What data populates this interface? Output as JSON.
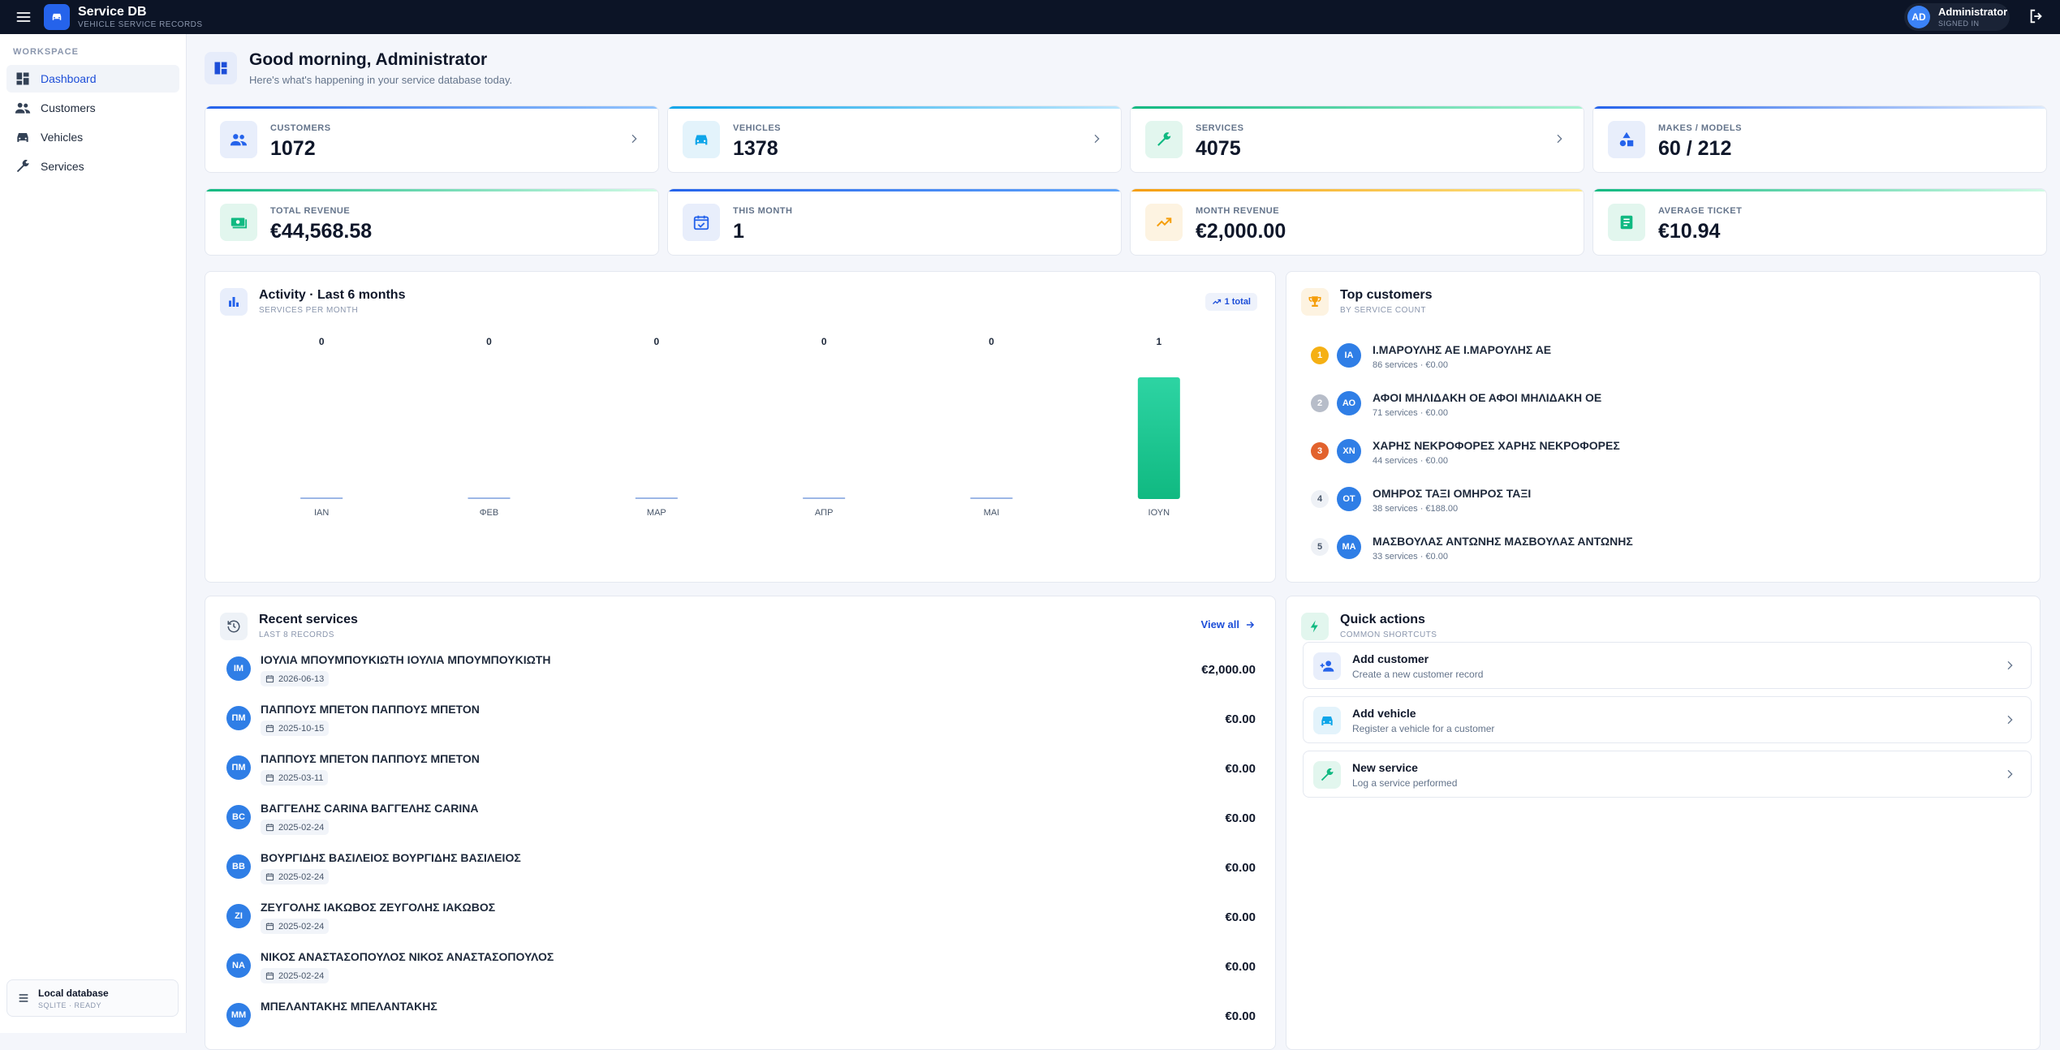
{
  "topbar": {
    "title": "Service DB",
    "subtitle": "VEHICLE SERVICE RECORDS",
    "user_initials": "AD",
    "user_name": "Administrator",
    "user_status": "SIGNED IN"
  },
  "sidebar": {
    "section_label": "WORKSPACE",
    "items": [
      {
        "label": "Dashboard",
        "icon": "dashboard-icon",
        "active": true
      },
      {
        "label": "Customers",
        "icon": "people-icon"
      },
      {
        "label": "Vehicles",
        "icon": "car-icon"
      },
      {
        "label": "Services",
        "icon": "wrench-icon"
      }
    ],
    "db_title": "Local database",
    "db_status": "SQLITE · READY"
  },
  "header": {
    "title": "Good morning, Administrator",
    "subtitle": "Here's what's happening in your service database today."
  },
  "stats": [
    {
      "label": "CUSTOMERS",
      "value": "1072",
      "icon": "people-icon",
      "color": "#2563eb"
    },
    {
      "label": "VEHICLES",
      "value": "1378",
      "icon": "car-icon",
      "color": "#0ea5e9"
    },
    {
      "label": "SERVICES",
      "value": "4075",
      "icon": "wrench-icon",
      "color": "#10b981"
    },
    {
      "label": "MAKES / MODELS",
      "value": "60 / 212",
      "icon": "shapes-icon",
      "color": "#2563eb"
    },
    {
      "label": "TOTAL REVENUE",
      "value": "€44,568.58",
      "icon": "cash-icon",
      "color": "#10b981"
    },
    {
      "label": "THIS MONTH",
      "value": "1",
      "icon": "calendar-check-icon",
      "color": "#2563eb"
    },
    {
      "label": "MONTH REVENUE",
      "value": "€2,000.00",
      "icon": "trending-up-icon",
      "color": "#f59e0b"
    },
    {
      "label": "AVERAGE TICKET",
      "value": "€10.94",
      "icon": "receipt-icon",
      "color": "#10b981"
    }
  ],
  "activity": {
    "title": "Activity · Last 6 months",
    "subtitle": "SERVICES PER MONTH",
    "badge": "1 total"
  },
  "chart_data": {
    "type": "bar",
    "categories": [
      "ΙΑΝ",
      "ΦΕΒ",
      "ΜΑΡ",
      "ΑΠΡ",
      "ΜΑΙ",
      "ΙΟΥΝ"
    ],
    "values": [
      0,
      0,
      0,
      0,
      0,
      1
    ],
    "ylim": [
      0,
      1
    ],
    "grid": false,
    "bar_color": "#10b981"
  },
  "top_customers": {
    "title": "Top customers",
    "subtitle": "BY SERVICE COUNT",
    "items": [
      {
        "rank": "1",
        "initials": "ΙΑ",
        "name": "Ι.ΜΑΡΟΥΛΗΣ ΑΕ Ι.ΜΑΡΟΥΛΗΣ ΑΕ",
        "meta": "86 services · €0.00"
      },
      {
        "rank": "2",
        "initials": "ΑΟ",
        "name": "ΑΦΟΙ ΜΗΛΙΔΑΚΗ ΟΕ ΑΦΟΙ ΜΗΛΙΔΑΚΗ ΟΕ",
        "meta": "71 services · €0.00"
      },
      {
        "rank": "3",
        "initials": "ΧΝ",
        "name": "ΧΑΡΗΣ ΝΕΚΡΟΦΟΡΕΣ ΧΑΡΗΣ ΝΕΚΡΟΦΟΡΕΣ",
        "meta": "44 services · €0.00"
      },
      {
        "rank": "4",
        "initials": "ΟΤ",
        "name": "ΟΜΗΡΟΣ ΤΑΞΙ ΟΜΗΡΟΣ ΤΑΞΙ",
        "meta": "38 services · €188.00"
      },
      {
        "rank": "5",
        "initials": "ΜΑ",
        "name": "ΜΑΣΒΟΥΛΑΣ ΑΝΤΩΝΗΣ ΜΑΣΒΟΥΛΑΣ ΑΝΤΩΝΗΣ",
        "meta": "33 services · €0.00"
      }
    ]
  },
  "recent": {
    "title": "Recent services",
    "subtitle": "LAST 8 RECORDS",
    "view_all": "View all",
    "items": [
      {
        "initials": "ΙΜ",
        "name": "ΙΟΥΛΙΑ ΜΠΟΥΜΠΟΥΚΙΩΤΗ ΙΟΥΛΙΑ ΜΠΟΥΜΠΟΥΚΙΩΤΗ",
        "date": "2026-06-13",
        "amount": "€2,000.00"
      },
      {
        "initials": "ΠΜ",
        "name": "ΠΑΠΠΟΥΣ ΜΠΕΤΟΝ ΠΑΠΠΟΥΣ ΜΠΕΤΟΝ",
        "date": "2025-10-15",
        "amount": "€0.00"
      },
      {
        "initials": "ΠΜ",
        "name": "ΠΑΠΠΟΥΣ ΜΠΕΤΟΝ ΠΑΠΠΟΥΣ ΜΠΕΤΟΝ",
        "date": "2025-03-11",
        "amount": "€0.00"
      },
      {
        "initials": "BC",
        "name": "ΒΑΓΓΕΛΗΣ CARINA ΒΑΓΓΕΛΗΣ CARINA",
        "date": "2025-02-24",
        "amount": "€0.00"
      },
      {
        "initials": "ΒΒ",
        "name": "ΒΟΥΡΓΙΔΗΣ ΒΑΣΙΛΕΙΟΣ ΒΟΥΡΓΙΔΗΣ ΒΑΣΙΛΕΙΟΣ",
        "date": "2025-02-24",
        "amount": "€0.00"
      },
      {
        "initials": "ΖΙ",
        "name": "ΖΕΥΓΟΛΗΣ ΙΑΚΩΒΟΣ ΖΕΥΓΟΛΗΣ ΙΑΚΩΒΟΣ",
        "date": "2025-02-24",
        "amount": "€0.00"
      },
      {
        "initials": "ΝΑ",
        "name": "ΝΙΚΟΣ ΑΝΑΣΤΑΣΟΠΟΥΛΟΣ ΝΙΚΟΣ ΑΝΑΣΤΑΣΟΠΟΥΛΟΣ",
        "date": "2025-02-24",
        "amount": "€0.00"
      },
      {
        "initials": "ΜΜ",
        "name": "ΜΠΕΛΑΝΤΑΚΗΣ ΜΠΕΛΑΝΤΑΚΗΣ",
        "date": "",
        "amount": "€0.00"
      }
    ]
  },
  "quick": {
    "title": "Quick actions",
    "subtitle": "COMMON SHORTCUTS",
    "items": [
      {
        "title": "Add customer",
        "sub": "Create a new customer record",
        "icon": "person-add-icon"
      },
      {
        "title": "Add vehicle",
        "sub": "Register a vehicle for a customer",
        "icon": "car-icon"
      },
      {
        "title": "New service",
        "sub": "Log a service performed",
        "icon": "wrench-icon"
      }
    ]
  }
}
